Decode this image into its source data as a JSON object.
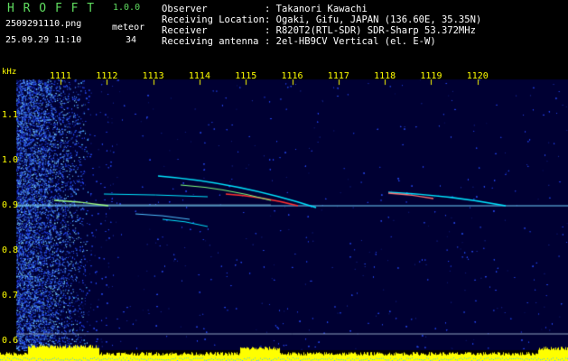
{
  "header": {
    "app_name": "H R O F F T",
    "version": "1.0.0",
    "filename": "2509291110.png",
    "timestamp": "25.09.29 11:10",
    "meteor_label": "meteor",
    "meteor_count": "34",
    "info_labels": [
      "Observer",
      "Receiving Location",
      "Receiver",
      "Receiving antenna"
    ],
    "info_values": [
      ": Takanori Kawachi",
      ": Ogaki, Gifu, JAPAN (136.60E, 35.35N)",
      ": R820T2(RTL-SDR) SDR-Sharp 53.372MHz",
      ": 2el-HB9CV Vertical (el. E-W)"
    ]
  },
  "chart_data": {
    "type": "heatmap",
    "ylabel": "kHz",
    "x_ticks": [
      "1111",
      "1112",
      "1113",
      "1114",
      "1115",
      "1116",
      "1117",
      "1118",
      "1119",
      "1120"
    ],
    "y_ticks": [
      "1.1",
      "1.0",
      "0.9",
      "0.8",
      "0.7",
      "0.6"
    ],
    "ylim": [
      0.58,
      1.18
    ],
    "carrier_khz": 0.9,
    "colors": {
      "background": "#000033",
      "noise": "#1a2fd0",
      "signal": "#00e5ff",
      "peak": "#ff3030",
      "power_trace": "#ffff00",
      "header_green": "#5fdc5f"
    }
  }
}
